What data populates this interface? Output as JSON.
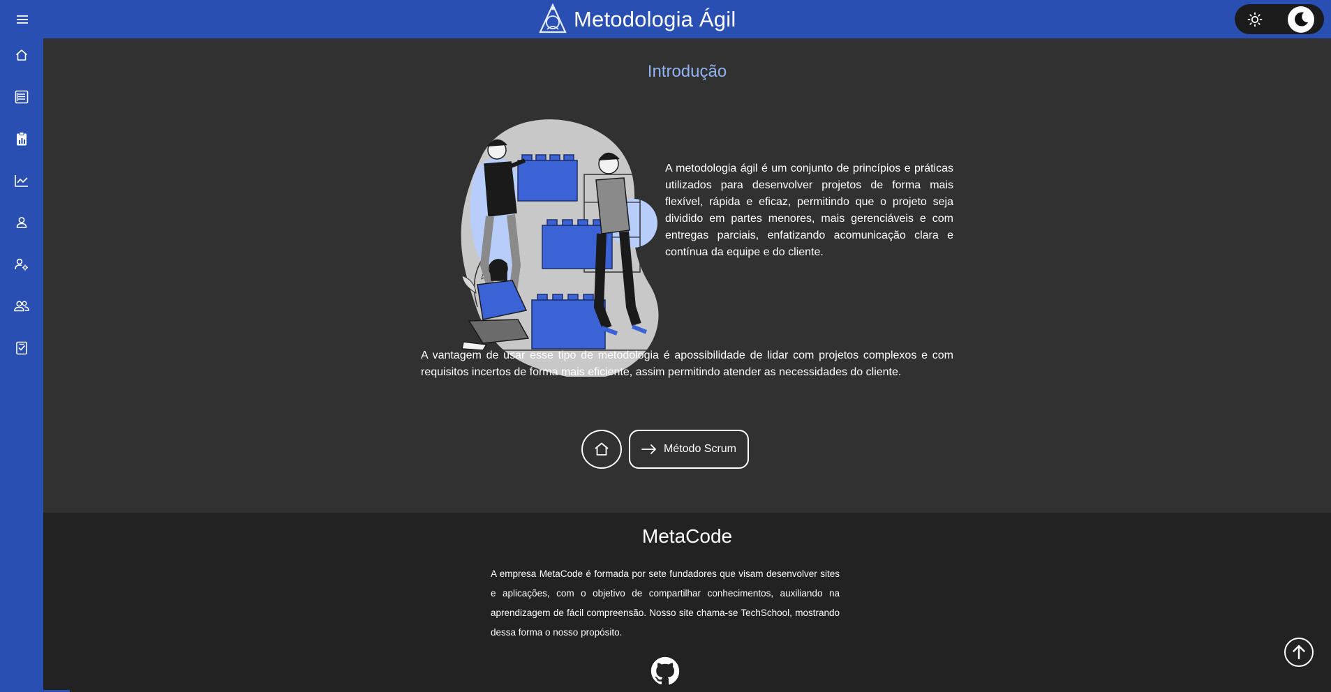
{
  "header": {
    "title": "Metodologia Ágil",
    "logo_icon": "triangle-compass-logo-icon",
    "menu_icon": "hamburger-menu-icon",
    "theme": {
      "light_icon": "sun-icon",
      "dark_icon": "moon-icon",
      "active": "dark"
    }
  },
  "sidebar": {
    "items": [
      {
        "name": "home",
        "icon": "home-icon"
      },
      {
        "name": "articles",
        "icon": "newspaper-icon"
      },
      {
        "name": "reports",
        "icon": "clipboard-chart-icon"
      },
      {
        "name": "charts",
        "icon": "line-chart-icon"
      },
      {
        "name": "user",
        "icon": "user-icon"
      },
      {
        "name": "user-settings",
        "icon": "user-gear-icon"
      },
      {
        "name": "team",
        "icon": "users-icon"
      },
      {
        "name": "tasks",
        "icon": "checklist-icon"
      }
    ]
  },
  "main": {
    "title": "Introdução",
    "paragraph1": "A metodologia ágil é um conjunto de princípios e práticas utilizados para desenvolver projetos de forma mais flexível, rápida e eficaz, permitindo que o projeto seja dividido em partes menores, mais gerenciáveis e com entregas parciais, enfatizando acomunicação clara e contínua da equipe e do cliente.",
    "paragraph2": "A vantagem de usar esse tipo de metodologia é apossibilidade de lidar com projetos complexos e com requisitos incertos de forma mais eficiente, assim permitindo atender as necessidades do cliente.",
    "home_button_icon": "home-icon",
    "next_button": {
      "label": "Método Scrum",
      "icon": "arrow-right-icon"
    }
  },
  "footer": {
    "title": "MetaCode",
    "text": "A empresa MetaCode é formada por sete fundadores que visam desenvolver sites e aplicações, com o objetivo de compartilhar conhecimentos, auxiliando na aprendizagem de fácil compreensão. Nosso site chama-se TechSchool, mostrando dessa forma o nosso propósito.",
    "github_icon": "github-icon",
    "scroll_top_icon": "arrow-up-circle-icon"
  },
  "colors": {
    "primary": "#2a4fb3",
    "background": "#313131",
    "footer": "#222222",
    "title_accent": "#8fb2f1",
    "illustration_blue": "#3c63d6"
  }
}
